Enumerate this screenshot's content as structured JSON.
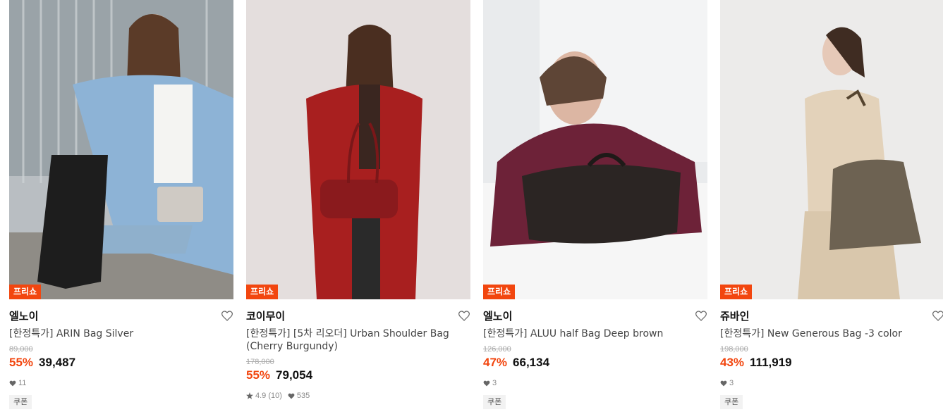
{
  "products": [
    {
      "badge": "프리쇼",
      "brand": "엘노이",
      "title": "[한정특가] ARIN Bag Silver",
      "original_price": "89,000",
      "discount": "55%",
      "price": "39,487",
      "likes": "11",
      "coupon": "쿠폰"
    },
    {
      "badge": "프리쇼",
      "brand": "코이무이",
      "title": "[한정특가] [5차 리오더] Urban Shoulder Bag (Cherry Burgundy)",
      "original_price": "178,000",
      "discount": "55%",
      "price": "79,054",
      "rating": "4.9 (10)",
      "likes": "535"
    },
    {
      "badge": "프리쇼",
      "brand": "엘노이",
      "title": "[한정특가] ALUU half Bag Deep brown",
      "original_price": "126,000",
      "discount": "47%",
      "price": "66,134",
      "likes": "3",
      "coupon": "쿠폰"
    },
    {
      "badge": "프리쇼",
      "brand": "쥬바인",
      "title": "[한정특가] New Generous Bag -3 color",
      "original_price": "198,000",
      "discount": "43%",
      "price": "111,919",
      "likes": "3",
      "coupon": "쿠폰"
    }
  ],
  "colors": {
    "accent": "#f2460f",
    "text": "#111111",
    "muted": "#888888"
  }
}
